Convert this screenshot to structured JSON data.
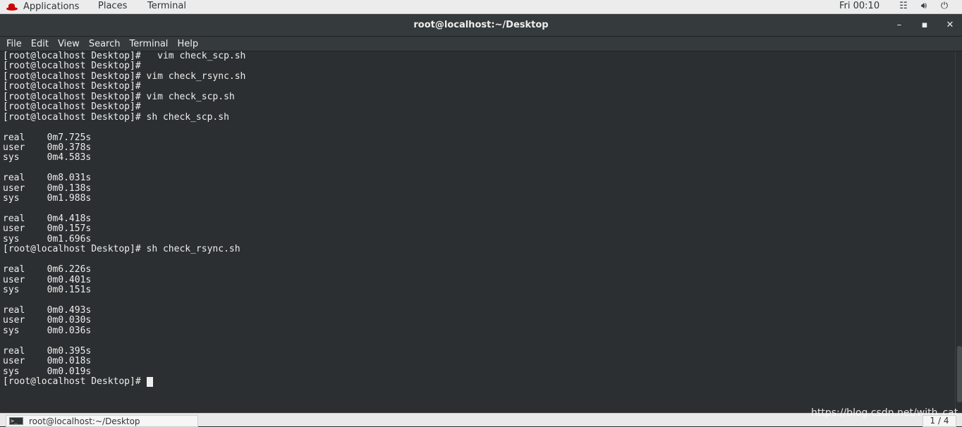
{
  "topbar": {
    "applications": "Applications",
    "places": "Places",
    "terminal": "Terminal",
    "clock": "Fri 00:10",
    "icons": [
      "network-icon",
      "volume-icon",
      "power-icon"
    ]
  },
  "window": {
    "title": "root@localhost:~/Desktop",
    "controls": [
      "minimize",
      "maximize",
      "close"
    ]
  },
  "menubar": {
    "items": [
      "File",
      "Edit",
      "View",
      "Search",
      "Terminal",
      "Help"
    ]
  },
  "terminal": {
    "lines": [
      "[root@localhost Desktop]#   vim check_scp.sh",
      "[root@localhost Desktop]#",
      "[root@localhost Desktop]# vim check_rsync.sh",
      "[root@localhost Desktop]#",
      "[root@localhost Desktop]# vim check_scp.sh",
      "[root@localhost Desktop]#",
      "[root@localhost Desktop]# sh check_scp.sh",
      "",
      "real\t0m7.725s",
      "user\t0m0.378s",
      "sys\t0m4.583s",
      "",
      "real\t0m8.031s",
      "user\t0m0.138s",
      "sys\t0m1.988s",
      "",
      "real\t0m4.418s",
      "user\t0m0.157s",
      "sys\t0m1.696s",
      "[root@localhost Desktop]# sh check_rsync.sh",
      "",
      "real\t0m6.226s",
      "user\t0m0.401s",
      "sys\t0m0.151s",
      "",
      "real\t0m0.493s",
      "user\t0m0.030s",
      "sys\t0m0.036s",
      "",
      "real\t0m0.395s",
      "user\t0m0.018s",
      "sys\t0m0.019s"
    ],
    "prompt": "[root@localhost Desktop]# "
  },
  "taskbar": {
    "task_label": "root@localhost:~/Desktop",
    "watermark": "https://blog.csdn.net/with_cat",
    "workspace": "1 / 4"
  }
}
